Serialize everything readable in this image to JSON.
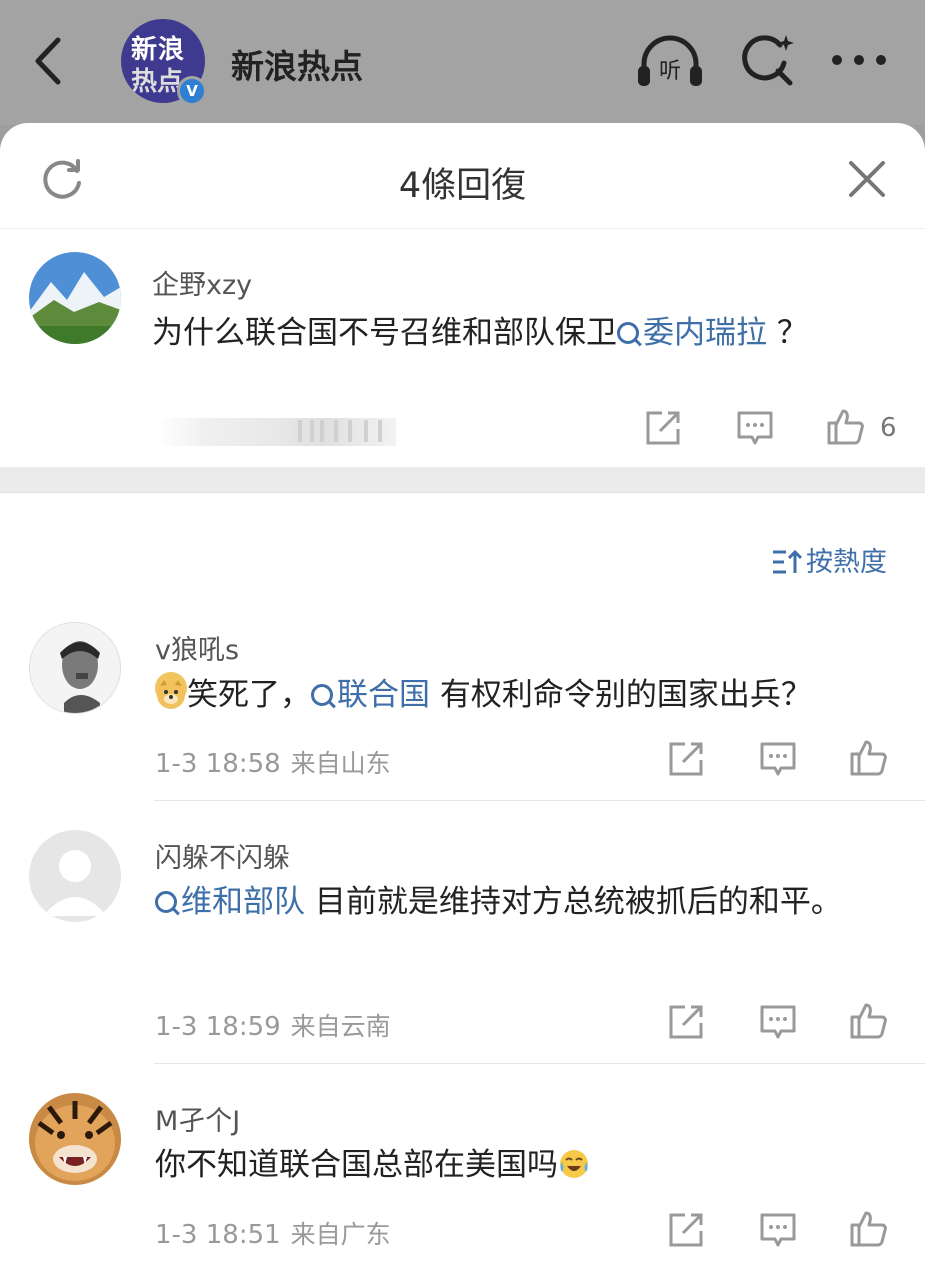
{
  "topbar": {
    "account_name": "新浪热点",
    "logo_line1": "新浪",
    "logo_line2": "热点",
    "verified_mark": "V",
    "listen_label": "听"
  },
  "sheet": {
    "title": "4條回復",
    "sort_label": "按熱度"
  },
  "root_comment": {
    "username": "企野xzy",
    "text_before": "为什么联合国不号召维和部队保卫",
    "topic": "委内瑞拉",
    "text_after": " ？",
    "like_count": "6"
  },
  "replies": [
    {
      "username": "v狼吼s",
      "emoji": "doge-emoji",
      "text_before": "笑死了，",
      "topic": "联合国",
      "text_after": " 有权利命令别的国家出兵？",
      "time": "1-3 18:58",
      "location": "来自山东"
    },
    {
      "username": "闪躲不闪躲",
      "topic": "维和部队",
      "text_after": " 目前就是维持对方总统被抓后的和平。",
      "time": "1-3 18:59",
      "location": "来自云南"
    },
    {
      "username": "M孑个J",
      "text_before": "你不知道联合国总部在美国吗",
      "emoji": "laugh-cry-emoji",
      "time": "1-3 18:51",
      "location": "来自广东"
    }
  ],
  "colors": {
    "topic_blue": "#3e6fa8",
    "overlay_gray": "#a3a3a3",
    "meta_gray": "#999999"
  }
}
